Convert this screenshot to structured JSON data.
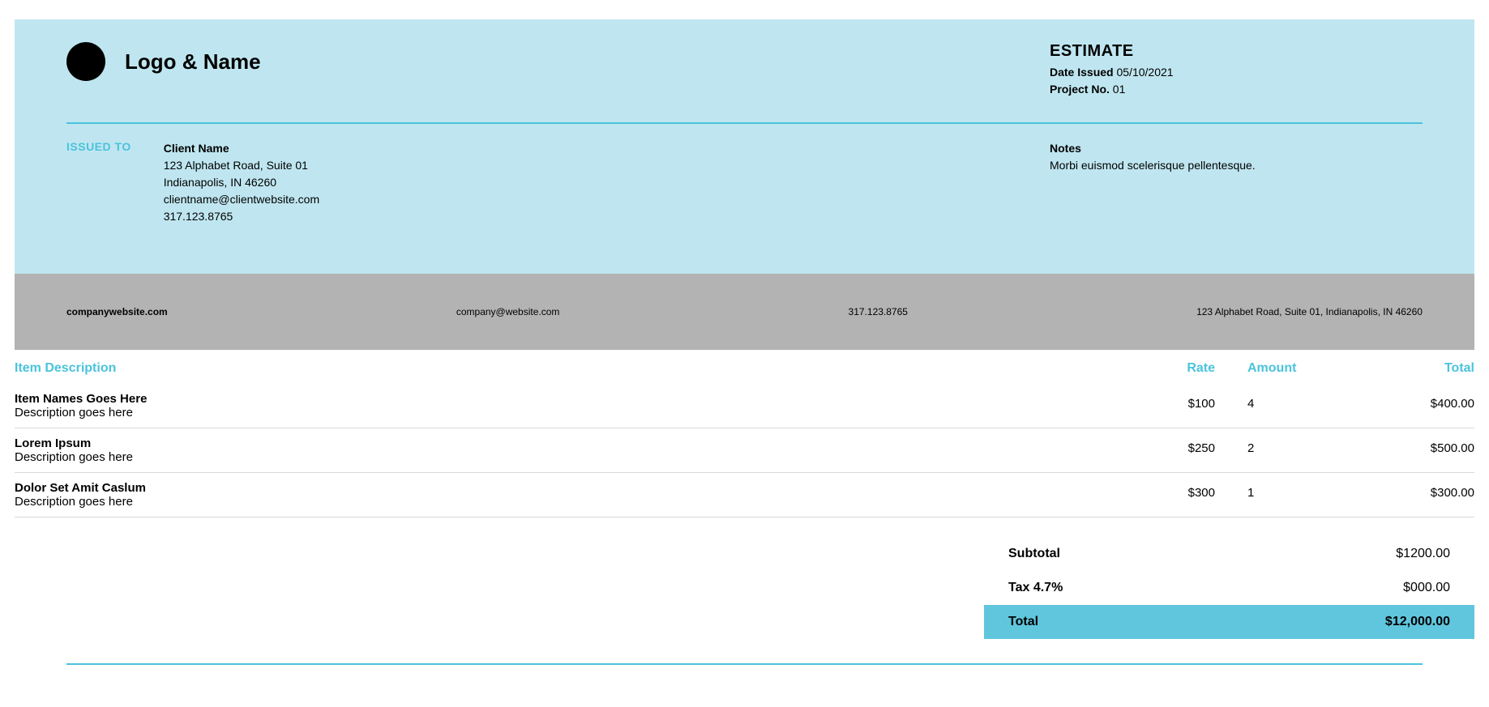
{
  "header": {
    "logo_text": "Logo & Name",
    "estimate_title": "ESTIMATE",
    "date_label": "Date Issued",
    "date_value": "05/10/2021",
    "project_label": "Project No.",
    "project_value": "01"
  },
  "issued": {
    "label": "ISSUED TO",
    "client_name": "Client Name",
    "address1": "123 Alphabet Road, Suite 01",
    "address2": "Indianapolis, IN 46260",
    "email": "clientname@clientwebsite.com",
    "phone": "317.123.8765"
  },
  "notes": {
    "label": "Notes",
    "text": "Morbi euismod scelerisque pellentesque."
  },
  "footer": {
    "website": "companywebsite.com",
    "email": "company@website.com",
    "phone": "317.123.8765",
    "address": "123 Alphabet Road, Suite 01, Indianapolis, IN 46260"
  },
  "table": {
    "headers": {
      "desc": "Item Description",
      "rate": "Rate",
      "amount": "Amount",
      "total": "Total"
    },
    "rows": [
      {
        "name": "Item Names Goes Here",
        "desc": "Description goes here",
        "rate": "$100",
        "amount": "4",
        "total": "$400.00"
      },
      {
        "name": "Lorem Ipsum",
        "desc": "Description goes here",
        "rate": "$250",
        "amount": "2",
        "total": "$500.00"
      },
      {
        "name": "Dolor Set Amit Caslum",
        "desc": "Description goes here",
        "rate": "$300",
        "amount": "1",
        "total": "$300.00"
      }
    ]
  },
  "summary": {
    "subtotal_label": "Subtotal",
    "subtotal_value": "$1200.00",
    "tax_label": "Tax 4.7%",
    "tax_value": "$000.00",
    "total_label": "Total",
    "total_value": "$12,000.00"
  }
}
